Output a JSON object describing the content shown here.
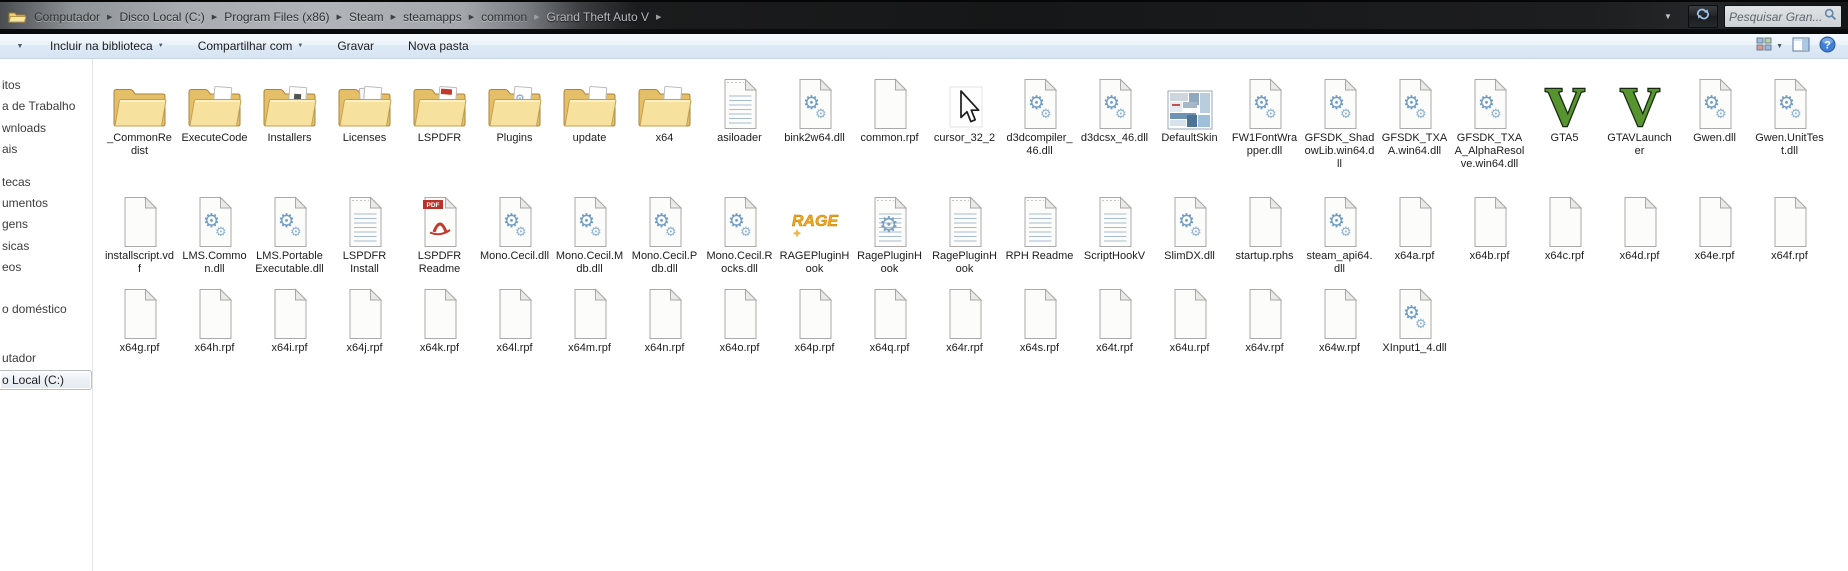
{
  "address_bar": {
    "breadcrumb": [
      "Computador",
      "Disco Local (C:)",
      "Program Files (x86)",
      "Steam",
      "steamapps",
      "common",
      "Grand Theft Auto V"
    ],
    "separator_icon": "chevron-right-icon",
    "leading_icon": "folder-icon",
    "dropdown_icon": "chevron-down-icon",
    "refresh_icon": "refresh-icon",
    "search_placeholder": "Pesquisar Gran...",
    "search_icon": "magnifier-icon"
  },
  "toolbar": {
    "overflow_caret": "▼",
    "buttons": [
      {
        "label": "Incluir na biblioteca",
        "dropdown": true
      },
      {
        "label": "Compartilhar com",
        "dropdown": true
      },
      {
        "label": "Gravar",
        "dropdown": false
      },
      {
        "label": "Nova pasta",
        "dropdown": false
      }
    ],
    "right_icons": [
      "views-icon",
      "preview-pane-icon",
      "help-icon"
    ]
  },
  "sidebar": {
    "items": [
      {
        "label": "itos",
        "selected": false
      },
      {
        "label": "a de Trabalho",
        "selected": false
      },
      {
        "label": "wnloads",
        "selected": false
      },
      {
        "label": "ais",
        "selected": false
      },
      {
        "label": "tecas",
        "selected": false
      },
      {
        "label": "umentos",
        "selected": false
      },
      {
        "label": "gens",
        "selected": false
      },
      {
        "label": "sicas",
        "selected": false
      },
      {
        "label": "eos",
        "selected": false
      },
      {
        "label": "o doméstico",
        "selected": false
      },
      {
        "label": "utador",
        "selected": false
      },
      {
        "label": "o Local (C:)",
        "selected": true
      }
    ]
  },
  "files": {
    "rows": [
      [
        {
          "name": "_CommonRedist",
          "icon": "folder"
        },
        {
          "name": "ExecuteCode",
          "icon": "folder-page"
        },
        {
          "name": "Installers",
          "icon": "folder-installer"
        },
        {
          "name": "Licenses",
          "icon": "folder-pages"
        },
        {
          "name": "LSPDFR",
          "icon": "folder-pdf"
        },
        {
          "name": "Plugins",
          "icon": "folder-gears"
        },
        {
          "name": "update",
          "icon": "folder-page"
        },
        {
          "name": "x64",
          "icon": "folder-page"
        },
        {
          "name": "asiloader",
          "icon": "doc-text"
        },
        {
          "name": "bink2w64.dll",
          "icon": "dll"
        },
        {
          "name": "common.rpf",
          "icon": "doc-blank"
        },
        {
          "name": "cursor_32_2",
          "icon": "cursor"
        },
        {
          "name": "d3dcompiler_46.dll",
          "icon": "dll"
        },
        {
          "name": "d3dcsx_46.dll",
          "icon": "dll"
        },
        {
          "name": "DefaultSkin",
          "icon": "image"
        },
        {
          "name": "FW1FontWrapper.dll",
          "icon": "dll"
        },
        {
          "name": "GFSDK_ShadowLib.win64.dll",
          "icon": "dll"
        },
        {
          "name": "GFSDK_TXAA.win64.dll",
          "icon": "dll"
        },
        {
          "name": "GFSDK_TXAA_AlphaResolve.win64.dll",
          "icon": "dll"
        },
        {
          "name": "GTA5",
          "icon": "gtav"
        },
        {
          "name": "GTAVLauncher",
          "icon": "gtav"
        },
        {
          "name": "Gwen.dll",
          "icon": "dll"
        },
        {
          "name": "Gwen.UnitTest.dll",
          "icon": "dll"
        }
      ],
      [
        {
          "name": "installscript.vdf",
          "icon": "doc-blank"
        },
        {
          "name": "LMS.Common.dll",
          "icon": "dll"
        },
        {
          "name": "LMS.PortableExecutable.dll",
          "icon": "dll"
        },
        {
          "name": "LSPDFR Install",
          "icon": "doc-text"
        },
        {
          "name": "LSPDFR Readme",
          "icon": "pdf"
        },
        {
          "name": "Mono.Cecil.dll",
          "icon": "dll"
        },
        {
          "name": "Mono.Cecil.Mdb.dll",
          "icon": "dll"
        },
        {
          "name": "Mono.Cecil.Pdb.dll",
          "icon": "dll"
        },
        {
          "name": "Mono.Cecil.Rocks.dll",
          "icon": "dll"
        },
        {
          "name": "RAGEPluginHook",
          "icon": "rage"
        },
        {
          "name": "RagePluginHook",
          "icon": "dll-lined"
        },
        {
          "name": "RagePluginHook",
          "icon": "doc-text"
        },
        {
          "name": "RPH Readme",
          "icon": "doc-text"
        },
        {
          "name": "ScriptHookV",
          "icon": "doc-text"
        },
        {
          "name": "SlimDX.dll",
          "icon": "dll"
        },
        {
          "name": "startup.rphs",
          "icon": "doc-blank"
        },
        {
          "name": "steam_api64.dll",
          "icon": "dll"
        },
        {
          "name": "x64a.rpf",
          "icon": "doc-blank"
        },
        {
          "name": "x64b.rpf",
          "icon": "doc-blank"
        },
        {
          "name": "x64c.rpf",
          "icon": "doc-blank"
        },
        {
          "name": "x64d.rpf",
          "icon": "doc-blank"
        },
        {
          "name": "x64e.rpf",
          "icon": "doc-blank"
        },
        {
          "name": "x64f.rpf",
          "icon": "doc-blank"
        }
      ],
      [
        {
          "name": "x64g.rpf",
          "icon": "doc-blank"
        },
        {
          "name": "x64h.rpf",
          "icon": "doc-blank"
        },
        {
          "name": "x64i.rpf",
          "icon": "doc-blank"
        },
        {
          "name": "x64j.rpf",
          "icon": "doc-blank"
        },
        {
          "name": "x64k.rpf",
          "icon": "doc-blank"
        },
        {
          "name": "x64l.rpf",
          "icon": "doc-blank"
        },
        {
          "name": "x64m.rpf",
          "icon": "doc-blank"
        },
        {
          "name": "x64n.rpf",
          "icon": "doc-blank"
        },
        {
          "name": "x64o.rpf",
          "icon": "doc-blank"
        },
        {
          "name": "x64p.rpf",
          "icon": "doc-blank"
        },
        {
          "name": "x64q.rpf",
          "icon": "doc-blank"
        },
        {
          "name": "x64r.rpf",
          "icon": "doc-blank"
        },
        {
          "name": "x64s.rpf",
          "icon": "doc-blank"
        },
        {
          "name": "x64t.rpf",
          "icon": "doc-blank"
        },
        {
          "name": "x64u.rpf",
          "icon": "doc-blank"
        },
        {
          "name": "x64v.rpf",
          "icon": "doc-blank"
        },
        {
          "name": "x64w.rpf",
          "icon": "doc-blank"
        },
        {
          "name": "XInput1_4.dll",
          "icon": "dll"
        }
      ]
    ]
  },
  "colors": {
    "folder_yellow": "#f6e29e",
    "toolbar_gradient_top": "#f6fafd",
    "toolbar_gradient_bottom": "#d6e4f3",
    "gta_green": "#57942f",
    "rage_orange": "#f1a71f",
    "pdf_red": "#b5352b",
    "dll_gear_blue": "#6f9cc6",
    "addressbar_dark": "#161718"
  }
}
